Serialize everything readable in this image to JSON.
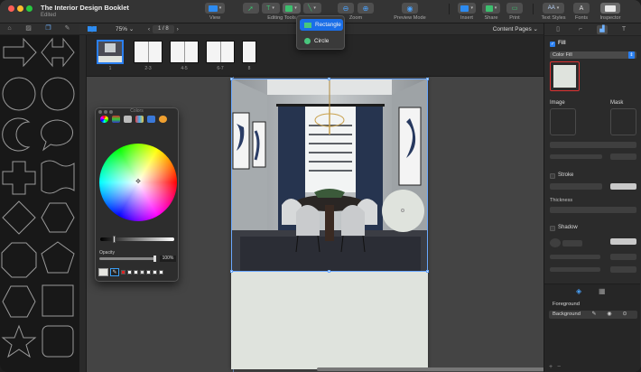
{
  "window": {
    "title": "The Interior Design Booklet",
    "subtitle": "Edited"
  },
  "toolbar": {
    "view_label": "View",
    "editing_tools_label": "Editing Tools",
    "zoom_label": "Zoom",
    "preview_mode_label": "Preview Mode",
    "insert_label": "Insert",
    "share_label": "Share",
    "print_label": "Print",
    "text_styles_label": "Text Styles",
    "fonts_label": "Fonts",
    "inspector_label": "Inspector",
    "text_tool_glyph": "T",
    "fonts_glyph": "A",
    "text_styles_glyph": "AA"
  },
  "shape_menu": {
    "items": [
      {
        "label": "Rectangle",
        "selected": true
      },
      {
        "label": "Circle",
        "selected": false
      }
    ]
  },
  "pagebar": {
    "zoom": "75%",
    "page_counter": "1 / 8",
    "content_pages": "Content Pages"
  },
  "thumbnails": [
    {
      "label": "1"
    },
    {
      "label": "2-3"
    },
    {
      "label": "4-5"
    },
    {
      "label": "6-7"
    },
    {
      "label": "8"
    }
  ],
  "colors_window": {
    "title": "Colors",
    "opacity_label": "Opacity",
    "opacity_value": "100%"
  },
  "inspector": {
    "fill_label": "Fill",
    "fill_type": "Color Fill",
    "image_label": "Image",
    "mask_label": "Mask",
    "stroke_label": "Stroke",
    "thickness_label": "Thickness",
    "shadow_label": "Shadow",
    "layers": [
      {
        "name": "Foreground"
      },
      {
        "name": "Background"
      }
    ]
  },
  "colors": {
    "accent": "#2a7ff0",
    "shape_fill": "#dfe3dd",
    "canvas": "#444444"
  }
}
